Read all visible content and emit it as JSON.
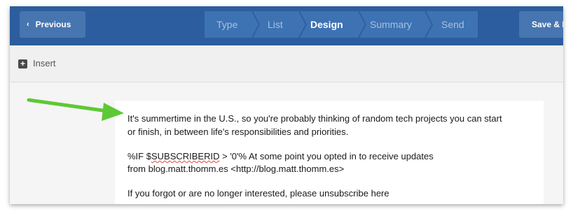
{
  "toolbar": {
    "previous_label": "Previous",
    "save_label": "Save & I",
    "steps": [
      {
        "label": "Type",
        "active": false
      },
      {
        "label": "List",
        "active": false
      },
      {
        "label": "Design",
        "active": true
      },
      {
        "label": "Summary",
        "active": false
      },
      {
        "label": "Send",
        "active": false
      }
    ]
  },
  "insert_bar": {
    "label": "Insert"
  },
  "editor": {
    "line1": "It's summertime in the U.S., so you're probably thinking of random tech projects you can start",
    "line2": "or finish, in between life's responsibilities and priorities.",
    "line3_prefix": "%IF $",
    "line3_misspelled": "SUBSCRIBERID",
    "line3_suffix": " > '0'%   At some point you opted in to receive updates",
    "line4": "from blog.matt.thomm.es <http://blog.matt.thomm.es>",
    "line5": "If you forgot or are no longer interested, please unsubscribe here"
  },
  "colors": {
    "topbar": "#2c5d9e",
    "button": "#4775b0",
    "steps_bg": "#3d72b3",
    "arrow": "#5ec934"
  },
  "icons": {
    "previous": "chevron-left-icon",
    "insert": "plus-square-icon",
    "annotation": "green-arrow"
  }
}
